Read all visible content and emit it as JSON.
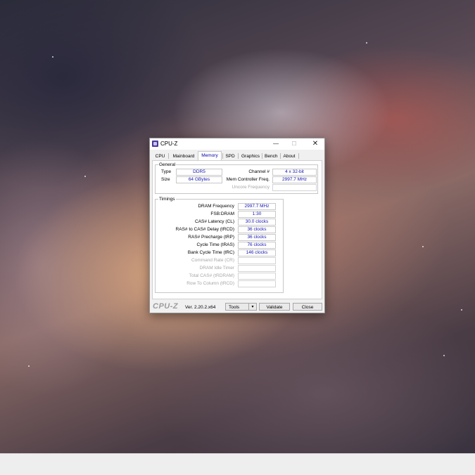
{
  "window": {
    "title": "CPU-Z",
    "controls": {
      "minimize": "—",
      "maximize": "☐",
      "close": "✕"
    }
  },
  "tabs": [
    "CPU",
    "Mainboard",
    "Memory",
    "SPD",
    "Graphics",
    "Bench",
    "About"
  ],
  "active_tab": "Memory",
  "general": {
    "title": "General",
    "type_label": "Type",
    "type_value": "DDR5",
    "size_label": "Size",
    "size_value": "64 GBytes",
    "channel_label": "Channel #",
    "channel_value": "4 x 32-bit",
    "mem_ctrl_label": "Mem Controller Freq.",
    "mem_ctrl_value": "2997.7 MHz",
    "uncore_label": "Uncore Frequency",
    "uncore_value": ""
  },
  "timings": {
    "title": "Timings",
    "rows": [
      {
        "label": "DRAM Frequency",
        "value": "2997.7 MHz",
        "disabled": false
      },
      {
        "label": "FSB:DRAM",
        "value": "1:30",
        "disabled": false
      },
      {
        "label": "CAS# Latency (CL)",
        "value": "30.0 clocks",
        "disabled": false
      },
      {
        "label": "RAS# to CAS# Delay (tRCD)",
        "value": "36 clocks",
        "disabled": false
      },
      {
        "label": "RAS# Precharge (tRP)",
        "value": "36 clocks",
        "disabled": false
      },
      {
        "label": "Cycle Time (tRAS)",
        "value": "76 clocks",
        "disabled": false
      },
      {
        "label": "Bank Cycle Time (tRC)",
        "value": "146 clocks",
        "disabled": false
      },
      {
        "label": "Command Rate (CR)",
        "value": "",
        "disabled": true
      },
      {
        "label": "DRAM Idle Timer",
        "value": "",
        "disabled": true
      },
      {
        "label": "Total CAS# (tRDRAM)",
        "value": "",
        "disabled": true
      },
      {
        "label": "Row To Column (tRCD)",
        "value": "",
        "disabled": true
      }
    ]
  },
  "footer": {
    "brand": "CPU-Z",
    "version": "Ver. 2.20.2.x64",
    "tools_label": "Tools",
    "tools_arrow": "▾",
    "validate_label": "Validate",
    "close_label": "Close"
  }
}
